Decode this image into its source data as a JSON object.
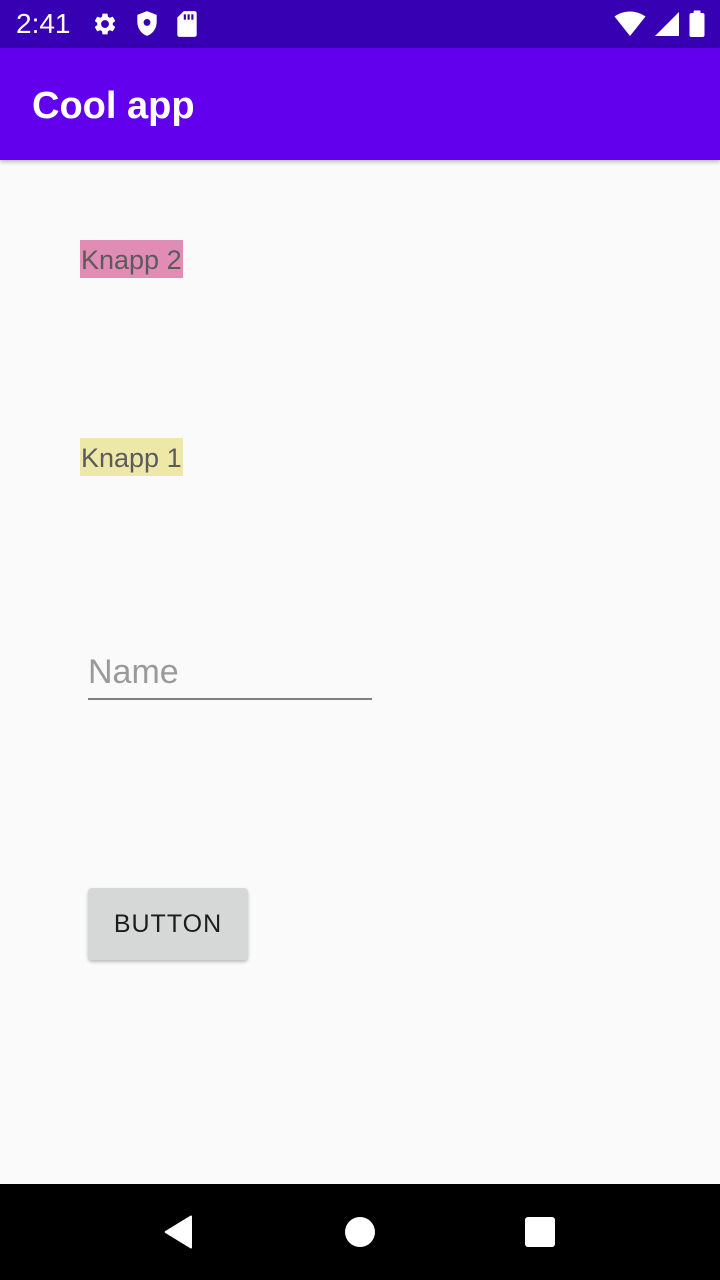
{
  "status_bar": {
    "time": "2:41",
    "left_icons": [
      "settings-icon",
      "shield-icon",
      "sd-card-icon"
    ],
    "right_icons": [
      "wifi-icon",
      "cell-signal-icon",
      "battery-icon"
    ],
    "color": "#3700b3"
  },
  "app_bar": {
    "title": "Cool app",
    "color": "#6200ee"
  },
  "content": {
    "knapp2_label": "Knapp 2",
    "knapp2_bg": "#e08cb4",
    "knapp1_label": "Knapp 1",
    "knapp1_bg": "#ede7a8",
    "name_field": {
      "placeholder": "Name",
      "value": ""
    },
    "button_label": "BUTTON"
  },
  "nav_bar": {
    "icons": [
      "back-icon",
      "home-icon",
      "recents-icon"
    ]
  }
}
